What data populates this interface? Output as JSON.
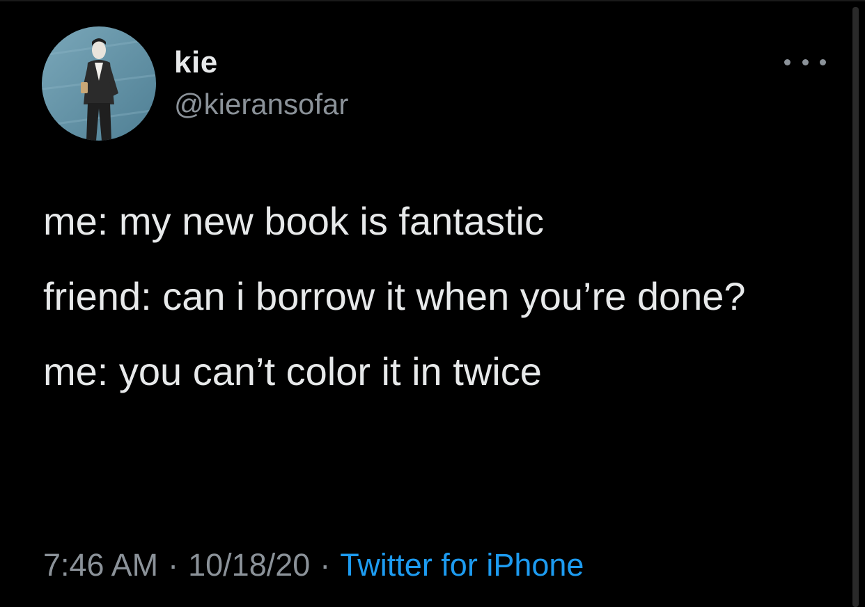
{
  "tweet": {
    "author": {
      "display_name": "kie",
      "handle": "@kieransofar",
      "avatar_icon": "person-illustration-avatar"
    },
    "more_icon": "ellipsis-icon",
    "text_lines": [
      "me: my new book is fantastic",
      "friend: can i borrow it when you’re done?",
      "me: you can’t color it in twice"
    ],
    "meta": {
      "time": "7:46 AM",
      "separator": "·",
      "date": "10/18/20",
      "source": "Twitter for iPhone"
    }
  },
  "colors": {
    "background": "#000000",
    "primary_text": "#e7e9ea",
    "secondary_text": "#8b9299",
    "link": "#1d9bf0",
    "avatar_bg": "#5f8fa4"
  }
}
